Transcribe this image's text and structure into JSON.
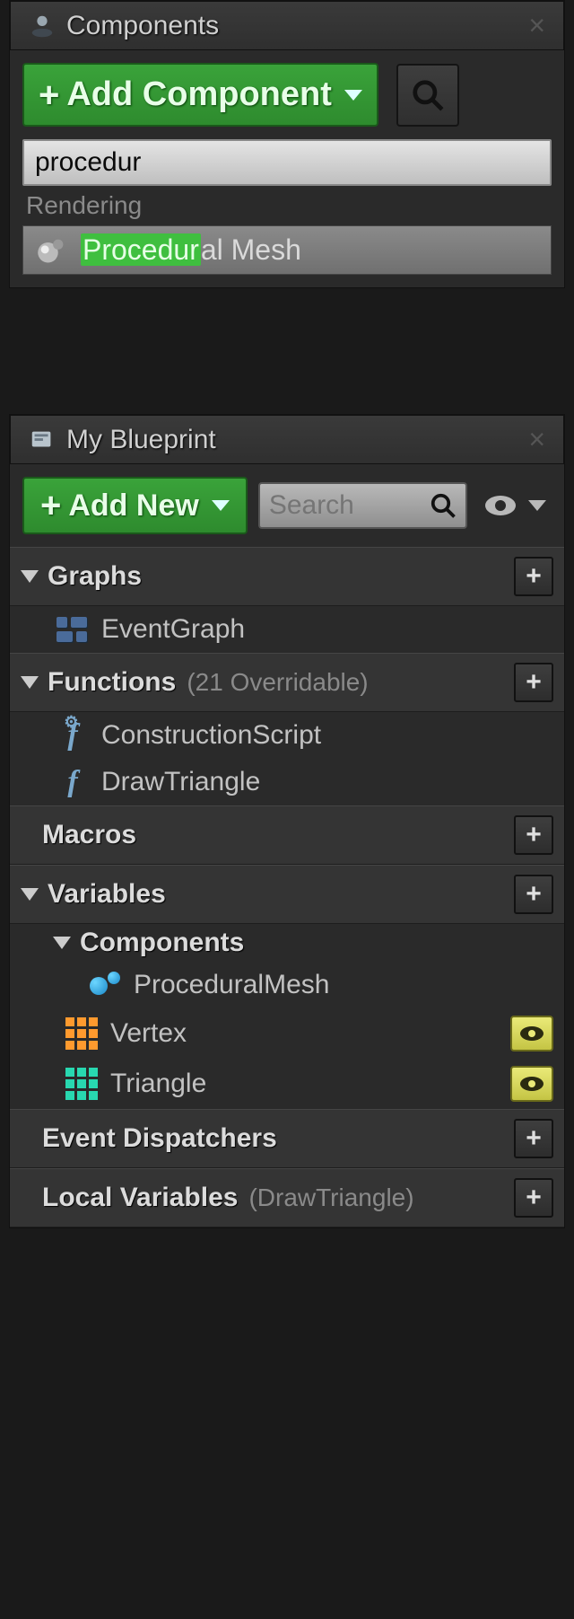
{
  "components_panel": {
    "tab_title": "Components",
    "add_button": "Add Component",
    "search_value": "procedur",
    "category": "Rendering",
    "result": {
      "match": "Procedur",
      "rest": "al Mesh"
    }
  },
  "blueprint_panel": {
    "tab_title": "My Blueprint",
    "add_button": "Add New",
    "search_placeholder": "Search",
    "sections": {
      "graphs": {
        "title": "Graphs"
      },
      "functions": {
        "title": "Functions",
        "subtitle": "(21 Overridable)"
      },
      "macros": {
        "title": "Macros"
      },
      "variables": {
        "title": "Variables"
      },
      "components": {
        "title": "Components"
      },
      "event_dispatchers": {
        "title": "Event Dispatchers"
      },
      "local_variables": {
        "title": "Local Variables",
        "subtitle": "(DrawTriangle)"
      }
    },
    "items": {
      "eventgraph": "EventGraph",
      "constructionscript": "ConstructionScript",
      "drawtriangle": "DrawTriangle",
      "proceduralmesh": "ProceduralMesh",
      "vertex": "Vertex",
      "triangle": "Triangle"
    }
  }
}
